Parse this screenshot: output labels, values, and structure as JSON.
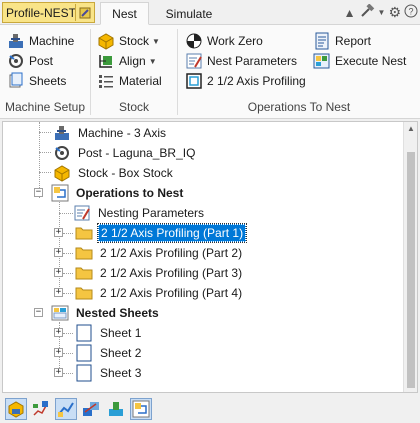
{
  "tabs": {
    "app": "Profile-NEST",
    "nest": "Nest",
    "simulate": "Simulate"
  },
  "ribbon": {
    "machine_setup": {
      "label": "Machine Setup",
      "machine": "Machine",
      "post": "Post",
      "sheets": "Sheets"
    },
    "stock": {
      "label": "Stock",
      "stock": "Stock",
      "align": "Align",
      "material": "Material"
    },
    "operations": {
      "label": "Operations To Nest",
      "work_zero": "Work Zero",
      "nest_parameters": "Nest Parameters",
      "profiling": "2 1/2 Axis Profiling",
      "report": "Report",
      "execute_nest": "Execute Nest"
    }
  },
  "tree": {
    "machine": "Machine - 3 Axis",
    "post": "Post - Laguna_BR_IQ",
    "stock": "Stock - Box Stock",
    "operations_to_nest": "Operations to Nest",
    "nesting_parameters": "Nesting Parameters",
    "operations": [
      "2 1/2 Axis Profiling (Part 1)",
      "2 1/2 Axis Profiling (Part 2)",
      "2 1/2 Axis Profiling (Part 3)",
      "2 1/2 Axis Profiling (Part 4)"
    ],
    "nested_sheets": "Nested Sheets",
    "sheets": [
      "Sheet 1",
      "Sheet 2",
      "Sheet 3"
    ]
  },
  "colors": {
    "selection": "#0078d7",
    "folder": "#f5c542",
    "app_tab": "#f9e488"
  }
}
